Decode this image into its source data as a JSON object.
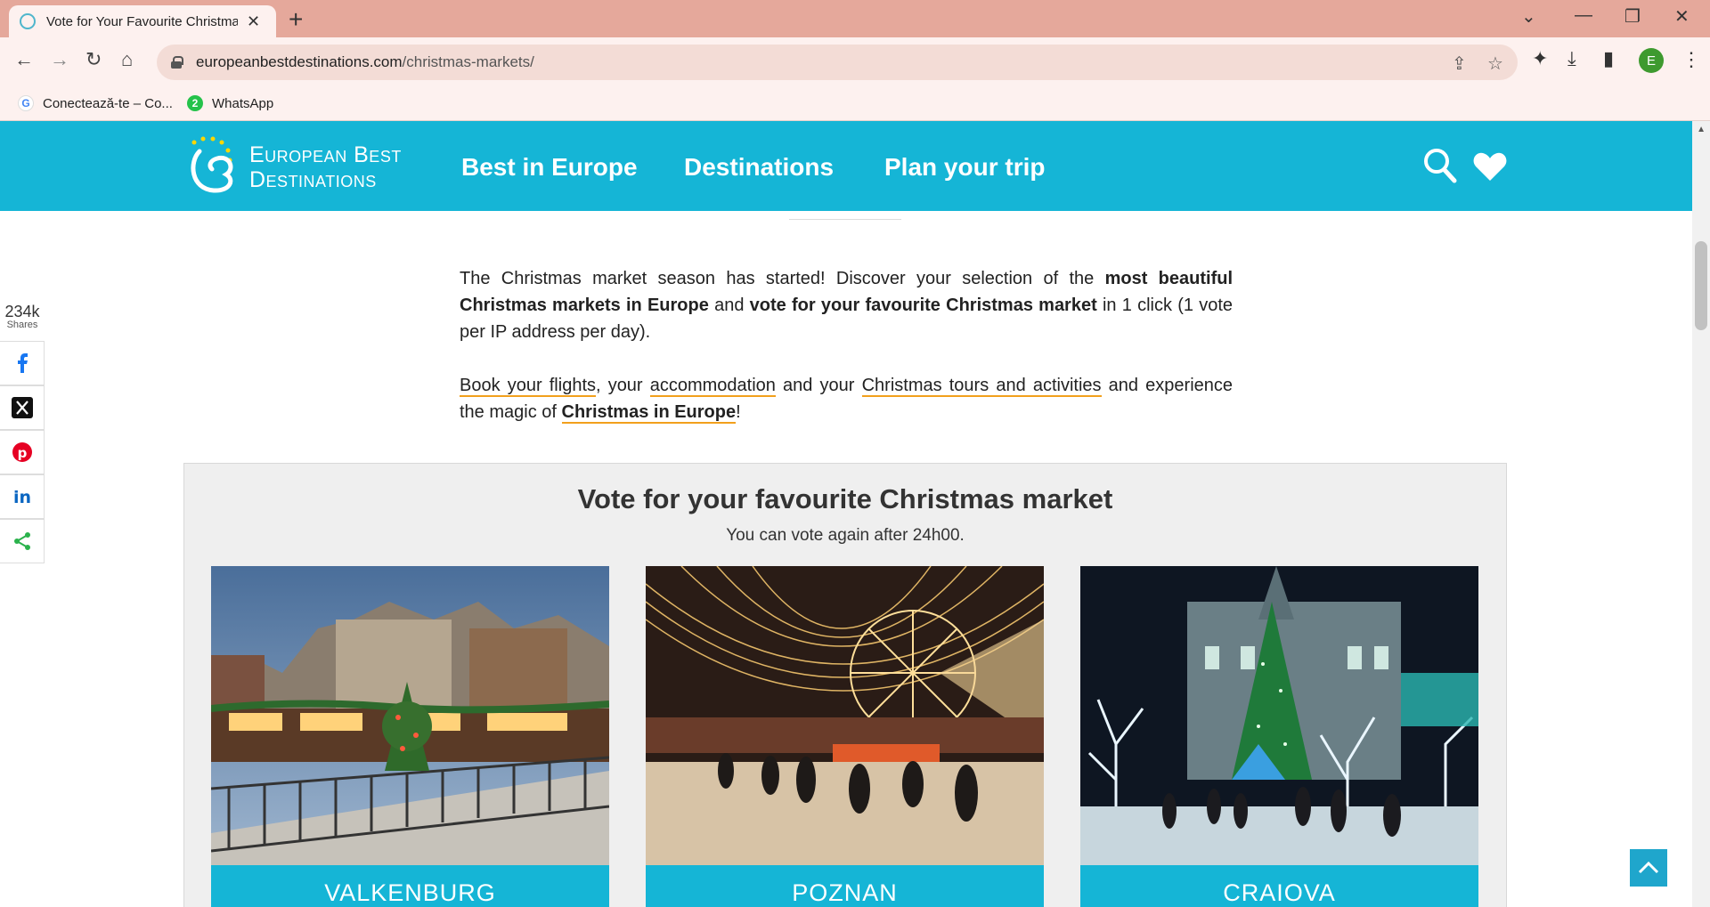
{
  "browser": {
    "tab_title": "Vote for Your Favourite Christmas",
    "url_host": "europeanbestdestinations.com",
    "url_path": "/christmas-markets/",
    "profile_initial": "E",
    "bookmarks": [
      {
        "label": "Conectează-te – Co...",
        "icon": "google-icon"
      },
      {
        "label": "WhatsApp",
        "icon": "whatsapp-icon",
        "badge": "2"
      }
    ]
  },
  "site": {
    "logo_line1": "European Best",
    "logo_line2": "Destinations",
    "nav": [
      "Best in Europe",
      "Destinations",
      "Plan your trip"
    ]
  },
  "intro": {
    "p1_a": "The Christmas market season has started! Discover your selection of the ",
    "p1_b": "most beautiful Christmas markets in Europe",
    "p1_c": " and ",
    "p1_d": "vote for your favourite Christmas market",
    "p1_e": " in 1 click (1 vote per IP address per day).",
    "p2_link1": "Book your flights",
    "p2_t1": ", your ",
    "p2_link2": "accommodation",
    "p2_t2": " and your ",
    "p2_link3": "Christmas tours and activities",
    "p2_t3": " and experience the magic of ",
    "p2_link4": "Christmas in Europe",
    "p2_t4": "!"
  },
  "share": {
    "count": "234k",
    "label": "Shares",
    "buttons": [
      "facebook-icon",
      "x-icon",
      "pinterest-icon",
      "linkedin-icon",
      "share-icon"
    ]
  },
  "vote": {
    "title": "Vote for your favourite Christmas market",
    "subtitle": "You can vote again after 24h00.",
    "cards": [
      {
        "name": "VALKENBURG"
      },
      {
        "name": "POZNAN"
      },
      {
        "name": "CRAIOVA"
      }
    ]
  },
  "colors": {
    "brand": "#15b5d6",
    "link_underline": "#f2a01c",
    "tabbar": "#e5a89b"
  }
}
